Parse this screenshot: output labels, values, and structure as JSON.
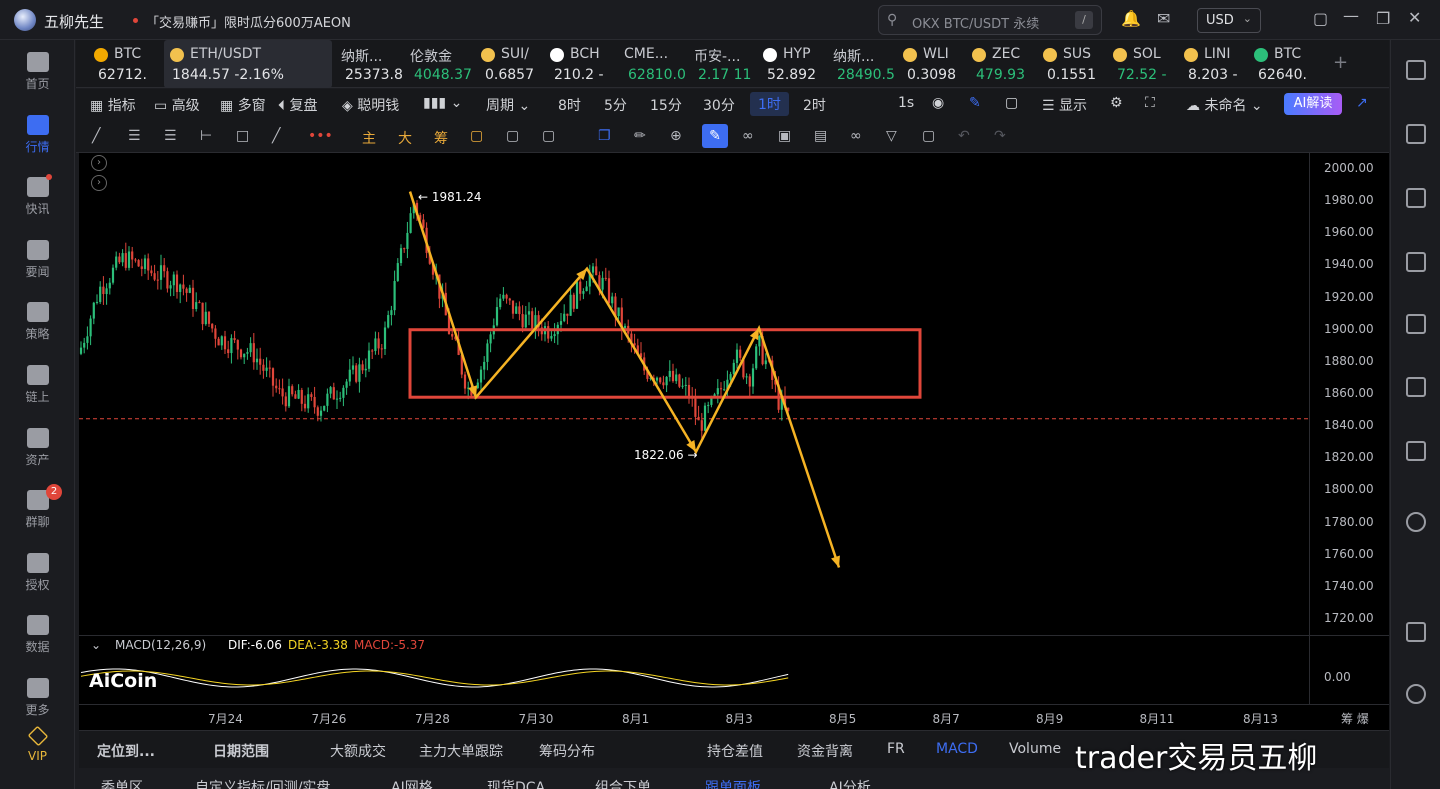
{
  "app": {
    "title": "五柳先生",
    "promo": "「交易赚币」限时瓜分600万AEON",
    "search_placeholder": "OKX BTC/USDT 永续",
    "search_key": "/",
    "currency": "USD"
  },
  "leftnav": [
    {
      "label": "首页",
      "icon": "home-icon"
    },
    {
      "label": "行情",
      "icon": "chart-bars-icon",
      "active": true
    },
    {
      "label": "快讯",
      "icon": "news-flash-icon",
      "dot": true
    },
    {
      "label": "要闻",
      "icon": "headlines-icon"
    },
    {
      "label": "策略",
      "icon": "strategy-icon"
    },
    {
      "label": "链上",
      "icon": "onchain-icon"
    },
    {
      "label": "资产",
      "icon": "wallet-icon"
    },
    {
      "label": "群聊",
      "icon": "chat-icon",
      "badge": "2"
    },
    {
      "label": "授权",
      "icon": "key-icon"
    },
    {
      "label": "数据",
      "icon": "data-icon"
    },
    {
      "label": "更多",
      "icon": "grid-icon"
    },
    {
      "label": "VIP",
      "icon": "vip-diamond-icon"
    }
  ],
  "tickers": [
    {
      "name": "BTC",
      "price": "62712.",
      "dir": "nt",
      "icon_color": "#f2a900"
    },
    {
      "name": "ETH/USDT",
      "price": "1844.57  -2.16%",
      "dir": "nt",
      "icon_color": "#f2c14e",
      "selected": true
    },
    {
      "name": "纳斯...",
      "price": "25373.8",
      "dir": "nt"
    },
    {
      "name": "伦敦金",
      "price": "4048.37",
      "dir": "up"
    },
    {
      "name": "SUI/",
      "price": "0.6857",
      "dir": "nt",
      "icon_color": "#f2c14e"
    },
    {
      "name": "BCH",
      "price": "210.2 -",
      "dir": "nt",
      "icon_color": "#ffffff"
    },
    {
      "name": "CME...",
      "price": "62810.0",
      "dir": "up"
    },
    {
      "name": "币安-...",
      "price": "2.17 11",
      "dir": "up"
    },
    {
      "name": "HYP",
      "price": "52.892",
      "dir": "nt",
      "icon_color": "#ffffff"
    },
    {
      "name": "纳斯...",
      "price": "28490.5",
      "dir": "up"
    },
    {
      "name": "WLI",
      "price": "0.3098",
      "dir": "nt",
      "icon_color": "#f2c14e"
    },
    {
      "name": "ZEC",
      "price": "479.93",
      "dir": "up",
      "icon_color": "#f2c14e"
    },
    {
      "name": "SUS",
      "price": "0.1551",
      "dir": "nt",
      "icon_color": "#f2c14e"
    },
    {
      "name": "SOL",
      "price": "72.52 -",
      "dir": "up",
      "icon_color": "#f2c14e"
    },
    {
      "name": "LINI",
      "price": "8.203 -",
      "dir": "nt",
      "icon_color": "#f2c14e"
    },
    {
      "name": "BTC",
      "price": "62640.",
      "dir": "nt",
      "icon_color": "#2cbf7a"
    }
  ],
  "toolbar": {
    "indicators": "指标",
    "advanced": "高级",
    "multi": "多窗",
    "replay": "复盘",
    "smart": "聪明钱",
    "period": "周期",
    "periods": [
      "8时",
      "5分",
      "15分",
      "30分",
      "1时",
      "2时"
    ],
    "active_period": "1时",
    "interval": "1s",
    "display": "显示",
    "unnamed": "未命名",
    "ai": "AI解读"
  },
  "drawtools": {
    "main": "主",
    "big": "大",
    "chips": "筹"
  },
  "chart": {
    "symbol": "ETH/USDT",
    "timeframe": "1h",
    "high_label": "← 1981.24",
    "low_label": "1822.06 →",
    "brand": "AiCoin"
  },
  "chart_data": {
    "type": "candlestick",
    "ylim": [
      1710,
      2010
    ],
    "yticks": [
      "2000.00",
      "1980.00",
      "1960.00",
      "1940.00",
      "1920.00",
      "1900.00",
      "1880.00",
      "1860.00",
      "1840.00",
      "1820.00",
      "1800.00",
      "1780.00",
      "1760.00",
      "1740.00",
      "1720.00"
    ],
    "xticks": [
      "7月24",
      "7月26",
      "7月28",
      "7月30",
      "8月1",
      "8月3",
      "8月5",
      "8月7",
      "8月9",
      "8月11",
      "8月13"
    ],
    "price_line": 1844.57,
    "box": {
      "x_from": "7月28",
      "x_to": "8月4",
      "y_low": 1858,
      "y_high": 1900
    },
    "annotations": [
      {
        "text": "1981.24",
        "kind": "high"
      },
      {
        "text": "1822.06",
        "kind": "low"
      }
    ],
    "macd": {
      "label": "MACD(12,26,9)",
      "dif": "DIF:-6.06",
      "dea": "DEA:-3.38",
      "macd": "MACD:-5.37",
      "axis": "0.00"
    }
  },
  "bottom": {
    "tabs": [
      "定位到...",
      "日期范围",
      "大额成交",
      "主力大单跟踪",
      "筹码分布",
      "持仓差值",
      "资金背离",
      "FR",
      "MACD",
      "Volume"
    ],
    "active": "MACD",
    "extra": "筹 爆",
    "watermark": "trader交易员五柳"
  },
  "bottom2": [
    "委单区",
    "自定义指标/回测/实盘",
    "AI网格",
    "现货DCA",
    "组合下单",
    "跟单面板",
    "AI分析"
  ],
  "colors": {
    "up": "#2cbf7a",
    "down": "#e0463a",
    "accent": "#3d6df2",
    "arrow": "#f5b324",
    "box": "#e0463a"
  }
}
